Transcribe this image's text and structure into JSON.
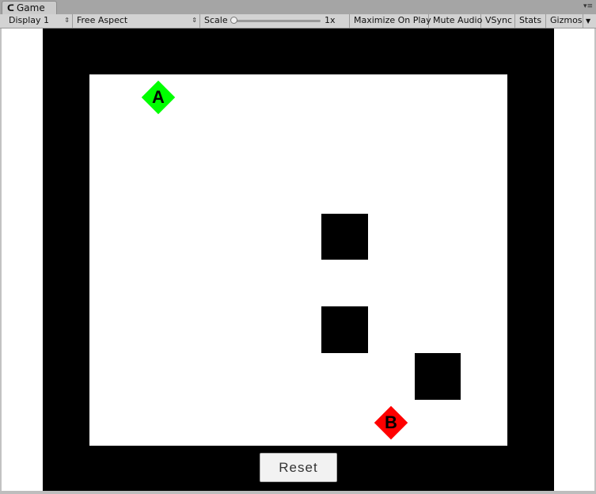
{
  "window": {
    "tab_title": "Game",
    "tab_icon": "unity-game-icon"
  },
  "toolbar": {
    "display": "Display 1",
    "aspect": "Free Aspect",
    "scale_label": "Scale",
    "scale_value": "1x",
    "maximize_on_play": "Maximize On Play",
    "mute_audio": "Mute Audio",
    "vsync": "VSync",
    "stats": "Stats",
    "gizmos": "Gizmos"
  },
  "game": {
    "start_label": "A",
    "end_label": "B",
    "start_color": "#00ff00",
    "end_color": "#ff0000",
    "reset_label": "Reset"
  },
  "colors": {
    "background": "#ffffff",
    "wall": "#000000"
  }
}
